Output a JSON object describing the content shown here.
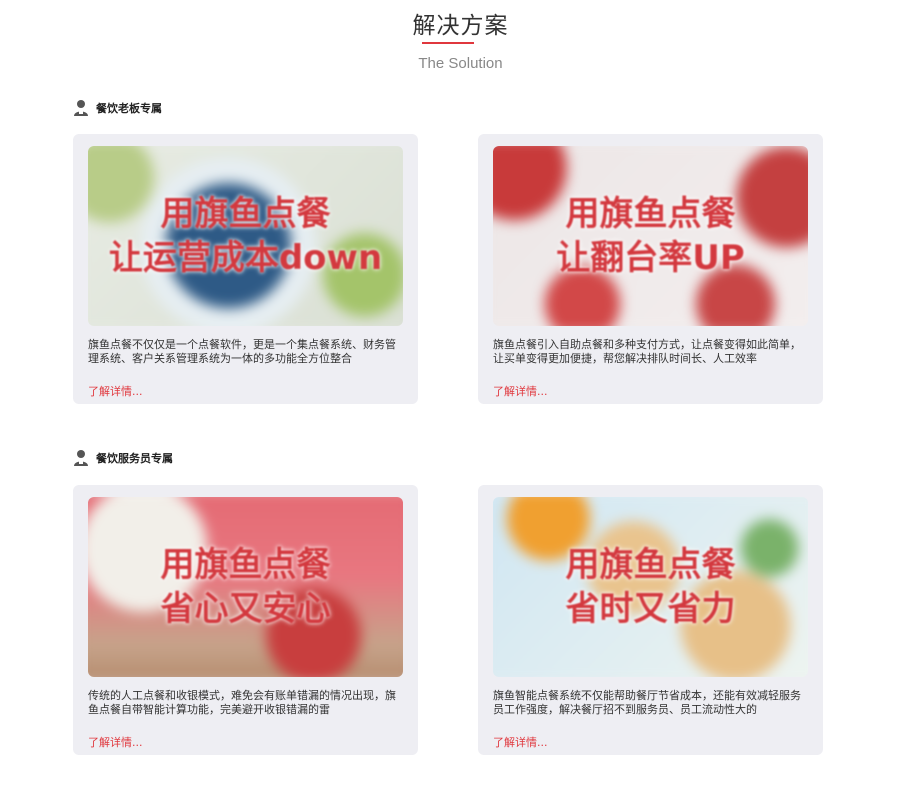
{
  "header": {
    "title": "解决方案",
    "subtitle": "The Solution"
  },
  "sections": [
    {
      "label": "餐饮老板专属",
      "cards": [
        {
          "caption_line1": "用旗鱼点餐",
          "caption_line2": "让运营成本down",
          "desc": "旗鱼点餐不仅仅是一个点餐软件，更是一个集点餐系统、财务管理系统、客户关系管理系统为一体的多功能全方位整合",
          "more": "了解详情..."
        },
        {
          "caption_line1": "用旗鱼点餐",
          "caption_line2": "让翻台率UP",
          "desc": "旗鱼点餐引入自助点餐和多种支付方式，让点餐变得如此简单，让买单变得更加便捷，帮您解决排队时间长、人工效率",
          "more": "了解详情..."
        }
      ]
    },
    {
      "label": "餐饮服务员专属",
      "cards": [
        {
          "caption_line1": "用旗鱼点餐",
          "caption_line2": "省心又安心",
          "desc": "传统的人工点餐和收银模式，难免会有账单错漏的情况出现，旗鱼点餐自带智能计算功能，完美避开收银错漏的雷",
          "more": "了解详情..."
        },
        {
          "caption_line1": "用旗鱼点餐",
          "caption_line2": "省时又省力",
          "desc": "旗鱼智能点餐系统不仅能帮助餐厅节省成本，还能有效减轻服务员工作强度，解决餐厅招不到服务员、员工流动性大的",
          "more": "了解详情..."
        }
      ]
    }
  ],
  "colors": {
    "accent": "#e0373d",
    "card_bg": "#eeeef3",
    "caption": "#d3393f"
  },
  "icons": {
    "section_icon": "user-icon"
  }
}
